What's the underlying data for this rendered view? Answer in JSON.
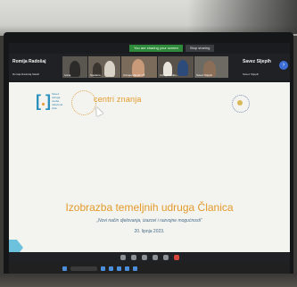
{
  "share_bar": {
    "sharing_label": "You are sharing your screen",
    "stop_label": "Stop sharing"
  },
  "participants": {
    "left_name": "Romija Radošaj",
    "left_sub": "Romija Radošaj Sladić",
    "right_name": "Savez Sljepih",
    "right_sub": "Savez Sljepih",
    "tiles": [
      {
        "caption": "Ivana"
      },
      {
        "caption": "Svetlana"
      },
      {
        "caption": "Udruga slijepih VŽ"
      },
      {
        "caption": "Udruga Zlatko..."
      },
      {
        "caption": "Savez Sljepih"
      }
    ]
  },
  "slide": {
    "org_lines": [
      "Savez",
      "udruga",
      "osoba",
      "oštećena",
      "vida"
    ],
    "brand": "centri znanja",
    "title": "Izobrazba temeljnih udruga Članica",
    "subtitle": "„Novi način djelovanja, izazovi i razvojne mogućnosti“",
    "date": "20. lipnja 2023."
  },
  "colors": {
    "accent_orange": "#e39a2b",
    "accent_blue": "#2b8fbd",
    "share_green": "#2e8a3a",
    "hangup_red": "#d9453a"
  }
}
